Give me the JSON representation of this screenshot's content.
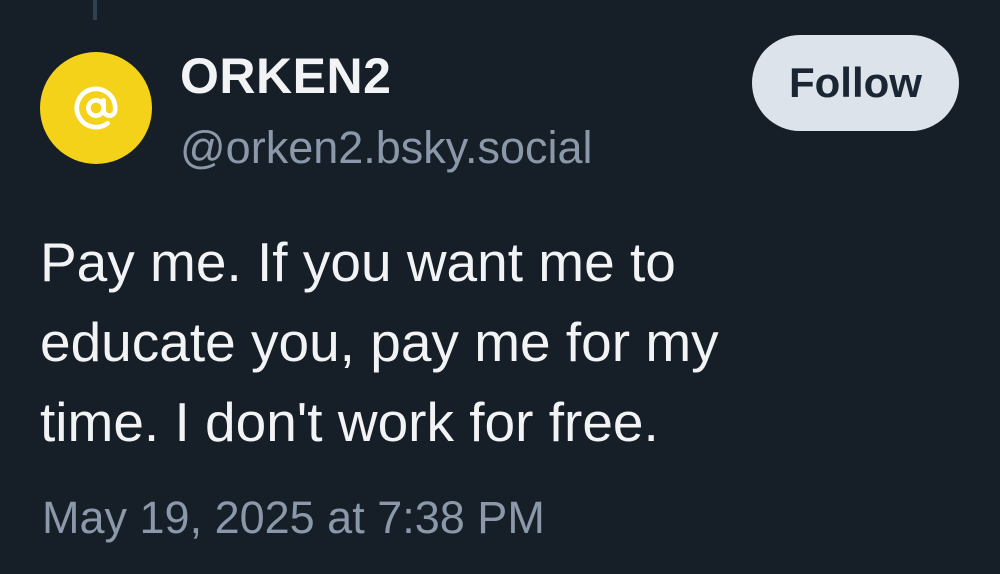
{
  "author": {
    "display_name": "ORKEN2",
    "handle": "@orken2.bsky.social",
    "avatar_icon": "at-sign-icon",
    "avatar_color": "#f3d219"
  },
  "actions": {
    "follow_label": "Follow"
  },
  "post": {
    "lines": [
      "Pay me. If you want me to",
      "educate you, pay me for my",
      "time. I don't work for free."
    ],
    "timestamp": "May 19, 2025 at 7:38 PM"
  },
  "colors": {
    "background": "#161e27",
    "primary_text": "#f1f3f5",
    "secondary_text": "#8b98a9",
    "button_bg": "#dde3ea",
    "button_text": "#1a2634"
  }
}
